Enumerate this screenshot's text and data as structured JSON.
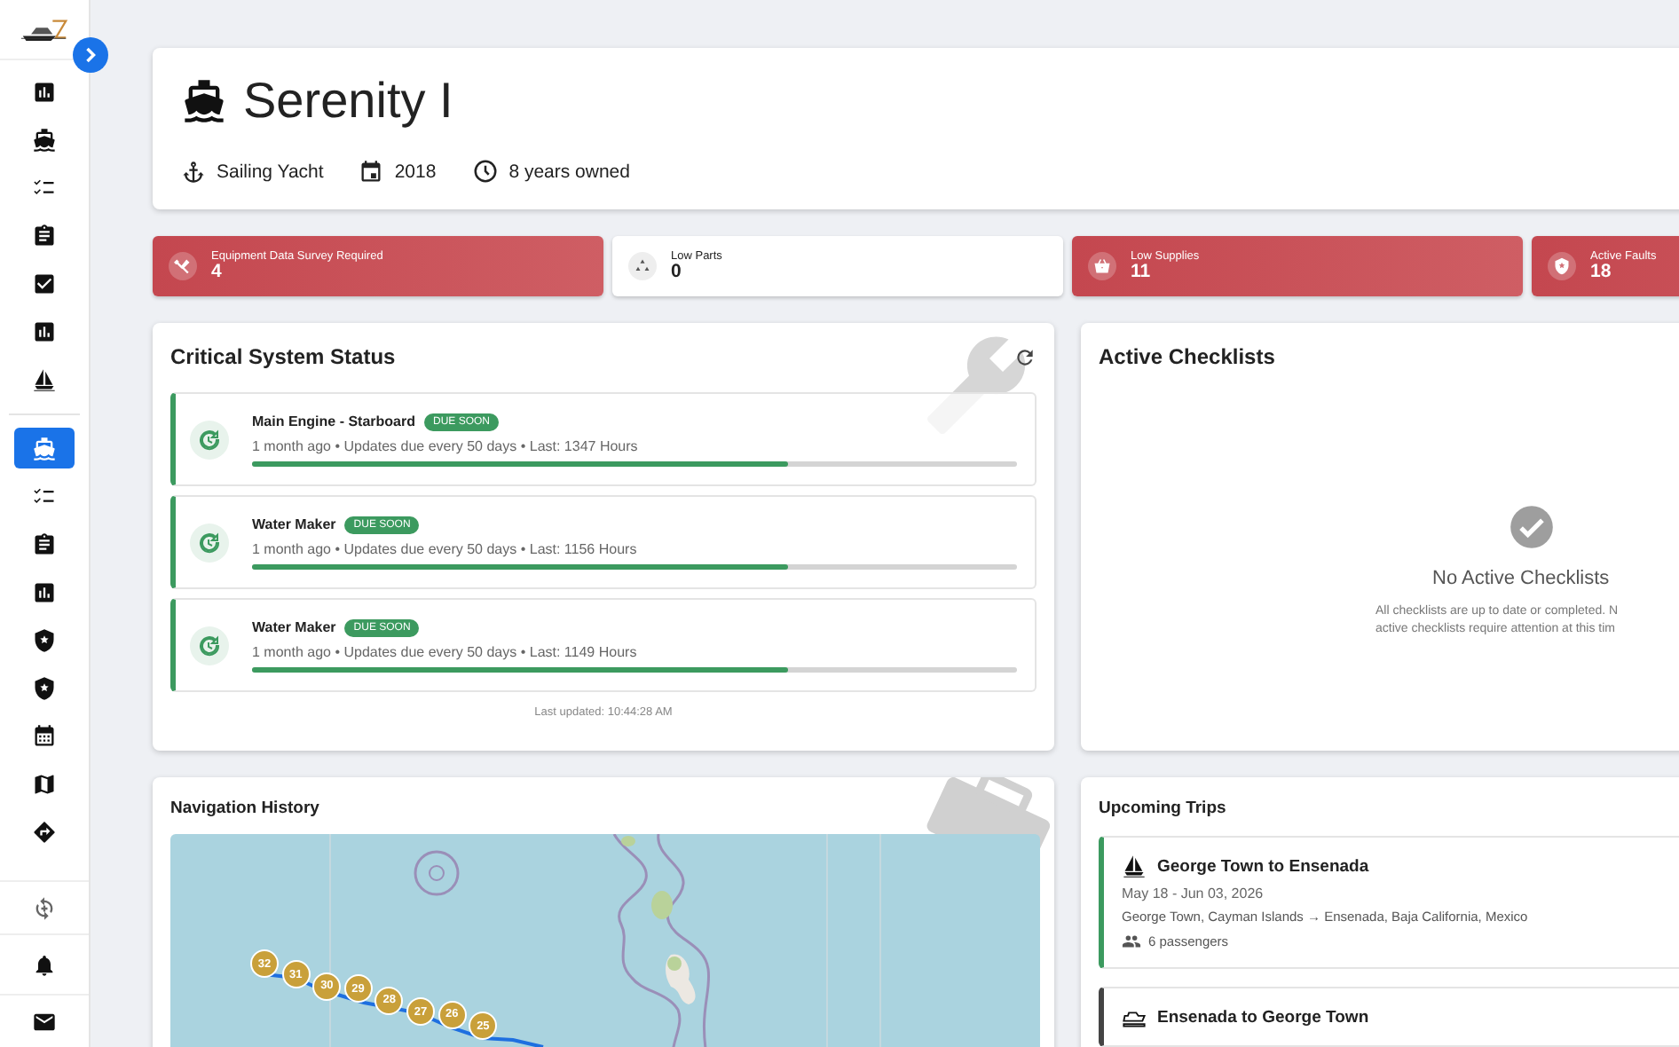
{
  "sidebar": {
    "items": [
      {
        "kind": "chart",
        "selected": false
      },
      {
        "kind": "ship",
        "selected": false
      },
      {
        "kind": "checklist",
        "selected": false
      },
      {
        "kind": "clipboard",
        "selected": false
      },
      {
        "kind": "checkbox",
        "selected": false
      },
      {
        "kind": "chart",
        "selected": false
      },
      {
        "kind": "sailboat",
        "selected": false
      },
      {
        "kind": "ship",
        "selected": true
      },
      {
        "kind": "checklist",
        "selected": false
      },
      {
        "kind": "clipboard",
        "selected": false
      },
      {
        "kind": "chart",
        "selected": false
      },
      {
        "kind": "shield",
        "selected": false
      },
      {
        "kind": "shield",
        "selected": false
      },
      {
        "kind": "calendar",
        "selected": false
      },
      {
        "kind": "map",
        "selected": false
      },
      {
        "kind": "directions",
        "selected": false
      }
    ],
    "bottom_items": [
      {
        "kind": "sync"
      },
      {
        "kind": "bell"
      },
      {
        "kind": "mail"
      }
    ]
  },
  "vessel": {
    "name": "Serenity I",
    "type": "Sailing Yacht",
    "year": "2018",
    "owned": "8 years owned"
  },
  "stats": [
    {
      "label": "Equipment Data Survey Required",
      "value": "4",
      "alert": true,
      "kind": "tools"
    },
    {
      "label": "Low Parts",
      "value": "0",
      "alert": false,
      "kind": "parts"
    },
    {
      "label": "Low Supplies",
      "value": "11",
      "alert": true,
      "kind": "basket"
    },
    {
      "label": "Active Faults",
      "value": "18",
      "alert": true,
      "kind": "shield"
    }
  ],
  "critical": {
    "title": "Critical System Status",
    "items": [
      {
        "name": "Main Engine - Starboard",
        "badge": "DUE SOON",
        "detail": "1 month ago • Updates due every 50 days • Last: 1347 Hours",
        "level": 0.7
      },
      {
        "name": "Water Maker",
        "badge": "DUE SOON",
        "detail": "1 month ago • Updates due every 50 days • Last: 1156 Hours",
        "level": 0.7
      },
      {
        "name": "Water Maker",
        "badge": "DUE SOON",
        "detail": "1 month ago • Updates due every 50 days • Last: 1149 Hours",
        "level": 0.7
      }
    ],
    "updated": "Last updated: 10:44:28 AM"
  },
  "checklists": {
    "title": "Active Checklists",
    "empty_title": "No Active Checklists",
    "empty_lines": [
      "All checklists are up to date or completed. N",
      "active checklists require attention at this tim"
    ]
  },
  "navigation": {
    "title": "Navigation History",
    "markers": [
      "32",
      "31",
      "30",
      "29",
      "28",
      "27",
      "26",
      "25"
    ]
  },
  "trips": {
    "title": "Upcoming Trips",
    "items": [
      {
        "kind": "sail",
        "color": "#3c9a5f",
        "title": "George Town to Ensenada",
        "dates": "May 18 - Jun 03, 2026",
        "route": "George Town, Cayman Islands → Ensenada, Baja California, Mexico",
        "passengers": "6 passengers"
      },
      {
        "kind": "motor",
        "color": "#444444",
        "title": "Ensenada to George Town"
      }
    ]
  }
}
